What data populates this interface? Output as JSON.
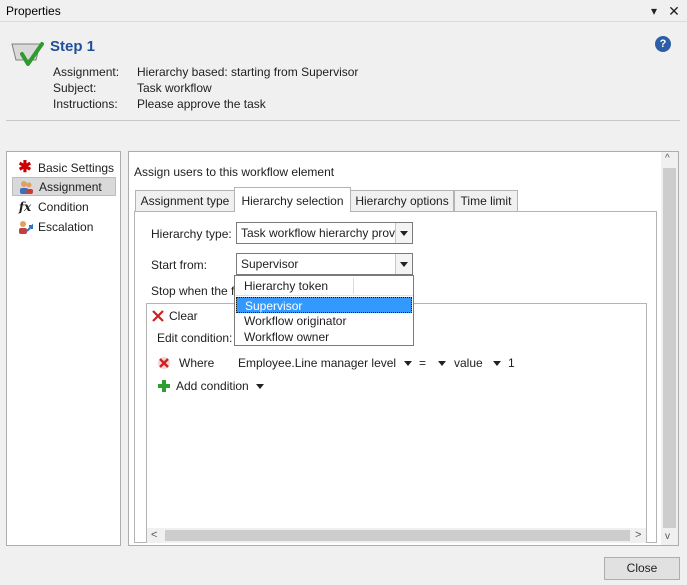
{
  "window": {
    "title": "Properties"
  },
  "header": {
    "step_title": "Step 1",
    "meta": [
      {
        "label": "Assignment:",
        "value": "Hierarchy based: starting from Supervisor"
      },
      {
        "label": "Subject:",
        "value": "Task workflow"
      },
      {
        "label": "Instructions:",
        "value": "Please approve the task"
      }
    ],
    "help": "?"
  },
  "nav": {
    "items": [
      {
        "label": "Basic Settings",
        "icon": "asterisk-icon"
      },
      {
        "label": "Assignment",
        "icon": "users-icon"
      },
      {
        "label": "Condition",
        "icon": "function-icon"
      },
      {
        "label": "Escalation",
        "icon": "escalation-icon"
      }
    ],
    "selected": "Assignment"
  },
  "panel": {
    "heading": "Assign users to this workflow element",
    "tabs": [
      "Assignment type",
      "Hierarchy selection",
      "Hierarchy options",
      "Time limit"
    ],
    "active_tab": "Hierarchy selection",
    "hierarchy_type_label": "Hierarchy type:",
    "hierarchy_type_value": "Task workflow hierarchy prov",
    "start_from_label": "Start from:",
    "start_from_value": "Supervisor",
    "stop_when_label": "Stop when the f",
    "dropdown": {
      "header": "Hierarchy token",
      "options": [
        "Supervisor",
        "Workflow originator",
        "Workflow owner"
      ],
      "highlighted": "Supervisor"
    },
    "conditions": {
      "clear_label": "Clear",
      "edit_label": "Edit condition:",
      "where": "Where",
      "field": "Employee.Line manager level",
      "operator": "=",
      "value_type": "value",
      "value": "1",
      "add_label": "Add condition"
    }
  },
  "footer": {
    "close_label": "Close"
  },
  "colors": {
    "accent": "#1f4e9a",
    "highlight": "#3399ff",
    "delete": "#cc2222",
    "add": "#2e9e2e"
  }
}
